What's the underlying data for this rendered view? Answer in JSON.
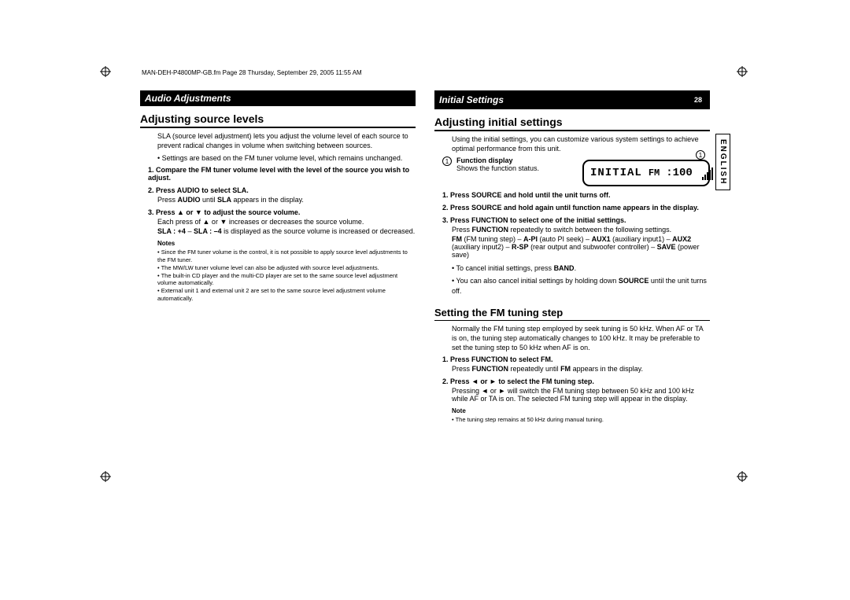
{
  "header": "MAN-DEH-P4800MP-GB.fm  Page 28  Thursday, September 29, 2005  11:55 AM",
  "language_tab": "ENGLISH",
  "page_number": "28",
  "left": {
    "section_bar": "Audio Adjustments",
    "title": "Adjusting source levels",
    "intro": "SLA (source level adjustment) lets you adjust the volume level of each source to prevent radical changes in volume when switching between sources.",
    "bullet1": "Settings are based on the FM tuner volume level, which remains unchanged.",
    "steps": [
      {
        "head": "1. Compare the FM tuner volume level with the level of the source you wish to adjust.",
        "desc": []
      },
      {
        "head": "2. Press AUDIO to select SLA.",
        "desc": [
          "Press <b>AUDIO</b> until <b>SLA</b> appears in the display."
        ]
      },
      {
        "head": "3. Press ▲ or ▼ to adjust the source volume.",
        "desc": [
          "Each press of ▲ or ▼ increases or decreases the source volume.",
          "<b>SLA : +4</b> – <b>SLA : –4</b> is displayed as the source volume is increased or decreased."
        ]
      }
    ],
    "notes_title": "Notes",
    "notes": [
      "Since the FM tuner volume is the control, it is not possible to apply source level adjustments to the FM tuner.",
      "The MW/LW tuner volume level can also be adjusted with source level adjustments.",
      "The built-in CD player and the multi-CD player are set to the same source level adjustment volume automatically.",
      "External unit 1 and external unit 2 are set to the same source level adjustment volume automatically."
    ]
  },
  "right": {
    "section_bar": "Initial Settings",
    "title": "Adjusting initial settings",
    "intro": "Using the initial settings, you can customize various system settings to achieve optimal performance from this unit.",
    "func_label": "Function display",
    "func_desc": "Shows the function status.",
    "display": {
      "text1": "INITIAL",
      "text2": "FM",
      "text3": ":100"
    },
    "steps": [
      {
        "head": "1. Press SOURCE and hold until the unit turns off.",
        "desc": []
      },
      {
        "head": "2. Press SOURCE and hold again until function name appears in the display.",
        "desc": []
      },
      {
        "head": "3. Press FUNCTION to select one of the initial settings.",
        "desc": [
          "Press <b>FUNCTION</b> repeatedly to switch between the following settings.",
          "<b>FM</b> (FM tuning step) – <b>A-PI</b> (auto PI seek) – <b>AUX1</b> (auxiliary input1) – <b>AUX2</b> (auxiliary input2) – <b>R-SP</b> (rear output and subwoofer controller) – <b>SAVE</b> (power save)"
        ]
      }
    ],
    "bullets": [
      "To cancel initial settings, press <b>BAND</b>.",
      "You can also cancel initial settings by holding down <b>SOURCE</b> until the unit turns off."
    ],
    "sub2_title": "Setting the FM tuning step",
    "sub2_intro": "Normally the FM tuning step employed by seek tuning is 50 kHz. When AF or TA is on, the tuning step automatically changes to 100 kHz. It may be preferable to set the tuning step to 50 kHz when AF is on.",
    "sub2_steps": [
      {
        "head": "1. Press FUNCTION to select FM.",
        "desc": [
          "Press <b>FUNCTION</b> repeatedly until <b>FM</b> appears in the display."
        ]
      },
      {
        "head": "2. Press ◄ or ► to select the FM tuning step.",
        "desc": [
          "Pressing ◄ or ► will switch the FM tuning step between 50 kHz and 100 kHz while AF or TA is on. The selected FM tuning step will appear in the display."
        ]
      }
    ],
    "note_title": "Note",
    "note": "The tuning step remains at 50 kHz during manual tuning."
  }
}
